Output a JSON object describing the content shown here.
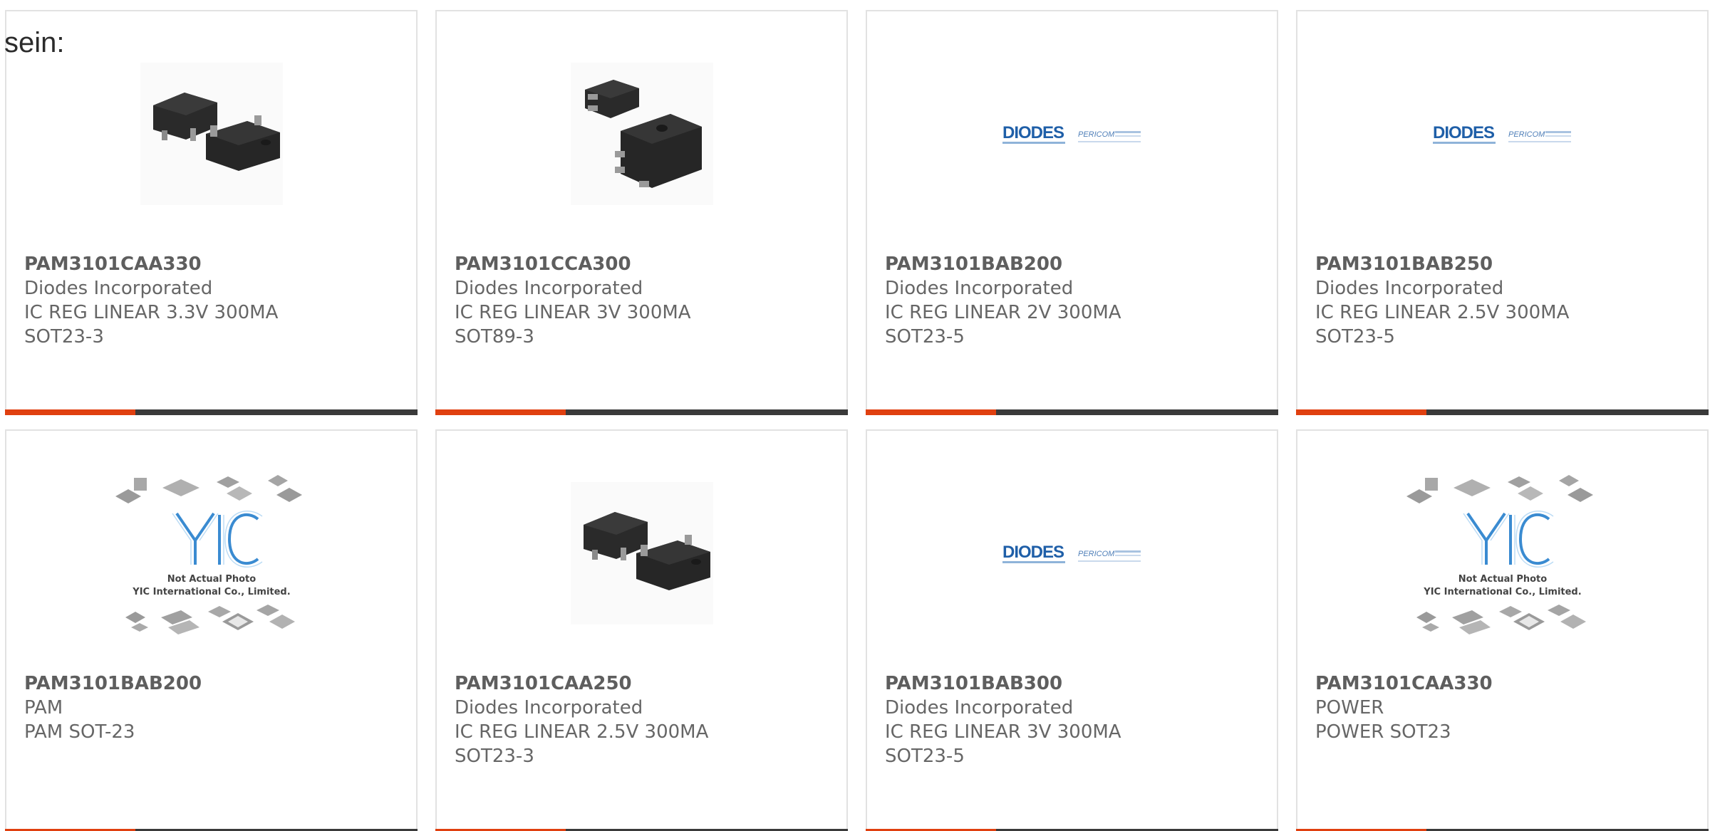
{
  "lead_text": "sein:",
  "colors": {
    "accent_bar": "#e04010",
    "dark_bar": "#3a3a3a",
    "diodes_blue": "#1f5fa8",
    "yic_blue": "#3a8bd1"
  },
  "products": [
    {
      "part_number": "PAM3101CAA330",
      "manufacturer": "Diodes Incorporated",
      "description_line1": "IC REG LINEAR 3.3V 300MA",
      "description_line2": "SOT23-3",
      "image": "sot23-package-photo"
    },
    {
      "part_number": "PAM3101CCA300",
      "manufacturer": "Diodes Incorporated",
      "description_line1": "IC REG LINEAR 3V 300MA",
      "description_line2": "SOT89-3",
      "image": "sot89-package-photo"
    },
    {
      "part_number": "PAM3101BAB200",
      "manufacturer": "Diodes Incorporated",
      "description_line1": "IC REG LINEAR 2V 300MA",
      "description_line2": "SOT23-5",
      "image": "diodes-pericom-logo"
    },
    {
      "part_number": "PAM3101BAB250",
      "manufacturer": "Diodes Incorporated",
      "description_line1": "IC REG LINEAR 2.5V 300MA",
      "description_line2": "SOT23-5",
      "image": "diodes-pericom-logo"
    },
    {
      "part_number": "PAM3101BAB200",
      "manufacturer": "PAM",
      "description_line1": "PAM SOT-23",
      "description_line2": "",
      "image": "yic-not-actual-photo",
      "placeholder_caption_1": "Not Actual Photo",
      "placeholder_caption_2": "YIC International Co., Limited."
    },
    {
      "part_number": "PAM3101CAA250",
      "manufacturer": "Diodes Incorporated",
      "description_line1": "IC REG LINEAR 2.5V 300MA",
      "description_line2": "SOT23-3",
      "image": "sot23-package-photo"
    },
    {
      "part_number": "PAM3101BAB300",
      "manufacturer": "Diodes Incorporated",
      "description_line1": "IC REG LINEAR 3V 300MA",
      "description_line2": "SOT23-5",
      "image": "diodes-pericom-logo"
    },
    {
      "part_number": "PAM3101CAA330",
      "manufacturer": "POWER",
      "description_line1": "POWER SOT23",
      "description_line2": "",
      "image": "yic-not-actual-photo",
      "placeholder_caption_1": "Not Actual Photo",
      "placeholder_caption_2": "YIC International Co., Limited."
    }
  ],
  "logo_text": {
    "diodes": "DIODES",
    "pericom": "PERICOM"
  }
}
